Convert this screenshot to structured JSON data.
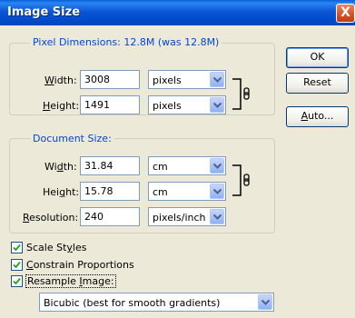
{
  "window": {
    "title": "Image Size",
    "close_glyph": "X"
  },
  "pixel_dimensions": {
    "label": "Pixel Dimensions:  12.8M (was 12.8M)",
    "width": {
      "label": "Width:",
      "value": "3008",
      "unit": "pixels"
    },
    "height": {
      "label": "Height:",
      "value": "1491",
      "unit": "pixels"
    }
  },
  "document_size": {
    "label": "Document Size:",
    "width": {
      "label": "Width:",
      "value": "31.84",
      "unit": "cm"
    },
    "height": {
      "label": "Height:",
      "value": "15.78",
      "unit": "cm"
    },
    "resolution": {
      "label": "Resolution:",
      "value": "240",
      "unit": "pixels/inch"
    }
  },
  "buttons": {
    "ok": "OK",
    "reset": "Reset",
    "auto": "Auto..."
  },
  "options": {
    "scale_styles": {
      "label": "Scale Styles",
      "checked": true
    },
    "constrain_proportions": {
      "label": "Constrain Proportions",
      "checked": true
    },
    "resample_image": {
      "label": "Resample Image:",
      "checked": true
    }
  },
  "resample_method": "Bicubic (best for smooth gradients)",
  "icons": {
    "chain_link": "chain-link-icon",
    "dropdown_arrow": "chevron-down-icon",
    "checkmark": "checkmark-icon",
    "close": "close-icon"
  }
}
